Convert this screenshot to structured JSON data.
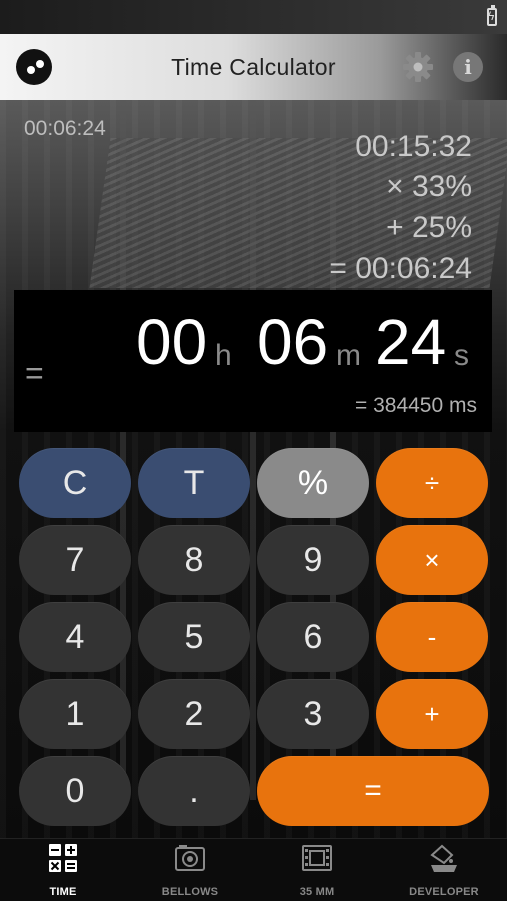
{
  "app": {
    "title": "Time Calculator"
  },
  "history": {
    "corner": "00:06:24",
    "lines": [
      "00:15:32",
      "× 33%",
      "+ 25%",
      "= 00:06:24"
    ]
  },
  "result": {
    "eq_sign": "=",
    "hours": "00",
    "hours_unit": "h",
    "minutes": "06",
    "minutes_unit": "m",
    "seconds": "24",
    "seconds_unit": "s",
    "ms": "= 384450 ms"
  },
  "keypad": {
    "clear": "C",
    "time": "T",
    "percent": "%",
    "divide": "÷",
    "seven": "7",
    "eight": "8",
    "nine": "9",
    "multiply": "×",
    "four": "4",
    "five": "5",
    "six": "6",
    "minus": "-",
    "one": "1",
    "two": "2",
    "three": "3",
    "plus": "+",
    "zero": "0",
    "dot": ".",
    "equals": "="
  },
  "nav": {
    "items": [
      {
        "label": "TIME",
        "icon": "calculator-icon",
        "active": true
      },
      {
        "label": "BELLOWS",
        "icon": "camera-icon",
        "active": false
      },
      {
        "label": "35 MM",
        "icon": "film-icon",
        "active": false
      },
      {
        "label": "DEVELOPER",
        "icon": "developer-tank-icon",
        "active": false
      }
    ]
  },
  "colors": {
    "accent": "#e8730d",
    "blue_key": "#3a4d71",
    "dark_key": "#333333",
    "grey_key": "#8a8a8a"
  }
}
